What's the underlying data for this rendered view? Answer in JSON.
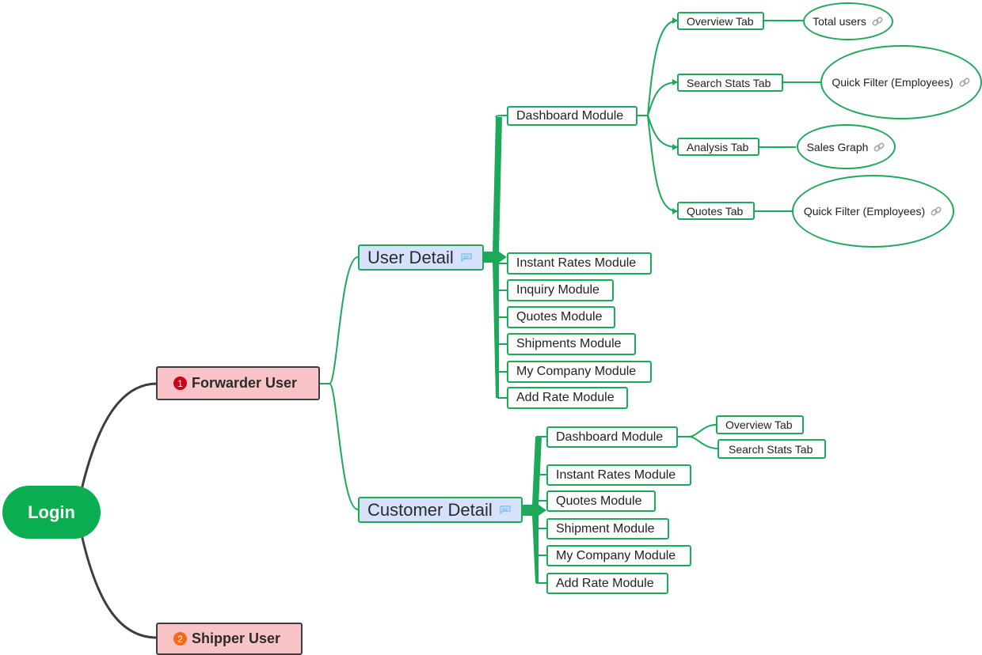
{
  "colors": {
    "root_fill": "#0aad4f",
    "branch_green": "#1ea85a",
    "user_fill": "#f8c4c8",
    "detail_fill": "#d6e2fb",
    "root_connector": "#3d3d3d",
    "badge_1": "#d0021b",
    "badge_2": "#f26a1b"
  },
  "root": {
    "label": "Login"
  },
  "users": [
    {
      "badge": "1",
      "label": "Forwarder User"
    },
    {
      "badge": "2",
      "label": "Shipper User"
    }
  ],
  "user_detail": {
    "label": "User Detail",
    "icon": "note-icon",
    "modules": [
      "Dashboard Module",
      "Instant Rates Module",
      "Inquiry Module",
      "Quotes Module",
      "Shipments Module",
      "My Company Module",
      "Add Rate Module"
    ],
    "dashboard_tabs": [
      {
        "tab": "Overview Tab",
        "leaf": "Total users",
        "leaf_icon": "link-icon"
      },
      {
        "tab": "Search Stats Tab",
        "leaf": "Quick Filter (Employees)",
        "leaf_icon": "link-icon"
      },
      {
        "tab": "Analysis Tab",
        "leaf": "Sales Graph",
        "leaf_icon": "link-icon"
      },
      {
        "tab": "Quotes Tab",
        "leaf": "Quick Filter (Employees)",
        "leaf_icon": "link-icon"
      }
    ]
  },
  "customer_detail": {
    "label": "Customer Detail",
    "icon": "note-icon",
    "modules": [
      "Dashboard Module",
      "Instant Rates Module",
      "Quotes Module",
      "Shipment Module",
      "My Company Module",
      "Add Rate Module"
    ],
    "dashboard_tabs": [
      "Overview Tab",
      "Search Stats Tab"
    ]
  }
}
